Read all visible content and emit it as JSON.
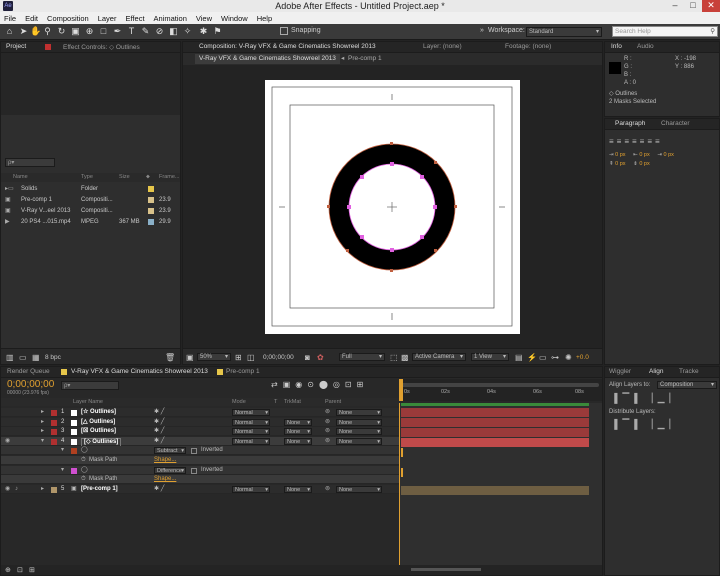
{
  "titlebar": {
    "title": "Adobe After Effects - Untitled Project.aep *",
    "app_icon": "Ae",
    "minimize": "–",
    "maximize": "□",
    "close": "✕"
  },
  "menu": [
    "File",
    "Edit",
    "Composition",
    "Layer",
    "Effect",
    "Animation",
    "View",
    "Window",
    "Help"
  ],
  "toolbar": {
    "snapping": "Snapping",
    "workspace_label": "Workspace:",
    "workspace_value": "Standard",
    "search_placeholder": "Search Help"
  },
  "project": {
    "tab": "Project",
    "effect_tab": "Effect Controls: ◇ Outlines",
    "search_placeholder": "ρ▾",
    "columns": {
      "name": "Name",
      "type": "Type",
      "size": "Size",
      "frame": "Frame..."
    },
    "items": [
      {
        "name": "Solids",
        "type": "Folder",
        "size": "",
        "frame": "",
        "color": "#e6c64a"
      },
      {
        "name": "Pre-comp 1",
        "type": "Compositi...",
        "size": "",
        "frame": "23.9",
        "color": "#d9c28a"
      },
      {
        "name": "V-Ray V...eel 2013",
        "type": "Compositi...",
        "size": "",
        "frame": "23.9",
        "color": "#d9c28a"
      },
      {
        "name": "20 PS4 ...015.mp4",
        "type": "MPEG",
        "size": "367 MB",
        "frame": "29.9",
        "color": "#8ab0c8"
      }
    ],
    "bpc": "8 bpc"
  },
  "comp": {
    "tab": "Composition: V-Ray VFX & Game Cinematics Showreel 2013",
    "layer_tab": "Layer: (none)",
    "footage_tab": "Footage: (none)",
    "crumbs": [
      "V-Ray VFX & Game Cinematics Showreel 2013",
      "Pre-comp 1"
    ],
    "zoom": "50%",
    "timecode": "0;00;00;00",
    "resolution": "Full",
    "camera": "Active Camera",
    "views": "1 View",
    "exposure": "+0.0"
  },
  "info": {
    "tab": "Info",
    "audio_tab": "Audio",
    "r": "R :",
    "g": "G :",
    "b": "B :",
    "a": "A : 0",
    "x": "X : -198",
    "y": "Y : 886",
    "layer_name": "◇ Outlines",
    "status": "2 Masks Selected"
  },
  "paragraph": {
    "tab": "Paragraph",
    "character_tab": "Character",
    "values": [
      "0 px",
      "0 px",
      "0 px",
      "0 px",
      "0 px"
    ]
  },
  "timeline": {
    "render_tab": "Render Queue",
    "comp_tab": "V-Ray VFX & Game Cinematics Showreel 2013",
    "precomp_tab": "Pre-comp 1",
    "timecode": "0;00;00;00",
    "fps": "00000 (23.976 fps)",
    "search_placeholder": "ρ▾",
    "columns": {
      "name": "Layer Name",
      "mode": "Mode",
      "t": "T",
      "trkmat": "TrkMat",
      "parent": "Parent"
    },
    "ruler": [
      "0s",
      "02s",
      "04s",
      "06s",
      "08s"
    ],
    "layers": [
      {
        "num": "1",
        "name": "[☆ Outlines]",
        "mode": "Normal",
        "trkmat": "",
        "parent": "None",
        "label": "#b03030"
      },
      {
        "num": "2",
        "name": "[△ Outlines]",
        "mode": "Normal",
        "trkmat": "None",
        "parent": "None",
        "label": "#b03030"
      },
      {
        "num": "3",
        "name": "[☒ Outlines]",
        "mode": "Normal",
        "trkmat": "None",
        "parent": "None",
        "label": "#b03030"
      },
      {
        "num": "4",
        "name": "[◇ Outlines]",
        "mode": "Normal",
        "trkmat": "None",
        "parent": "None",
        "label": "#b03030"
      }
    ],
    "masks": [
      {
        "mode": "Subtract",
        "inverted": "Inverted",
        "prop": "Mask Path",
        "shape": "Shape..."
      },
      {
        "mode": "Difference",
        "inverted": "Inverted",
        "prop": "Mask Path",
        "shape": "Shape..."
      }
    ],
    "layer5": {
      "num": "5",
      "name": "[Pre-comp 1]",
      "mode": "Normal",
      "trkmat": "None",
      "parent": "None"
    }
  },
  "rightpanel": {
    "wiggler_tab": "Wiggler",
    "align_tab": "Align",
    "tracker_tab": "Tracke",
    "align_to_label": "Align Layers to:",
    "align_to_value": "Composition",
    "distribute_label": "Distribute Layers:"
  }
}
